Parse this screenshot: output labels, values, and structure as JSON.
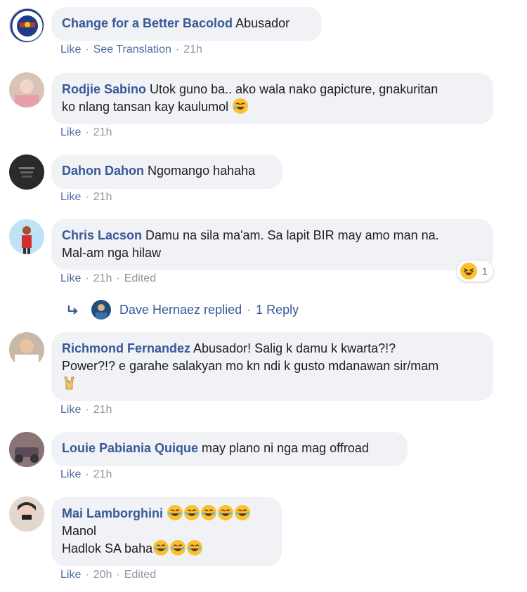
{
  "comments": [
    {
      "author": "Change for a Better Bacolod",
      "text": "Abusador",
      "actions": {
        "like": "Like",
        "see_translation": "See Translation",
        "time": "21h"
      }
    },
    {
      "author": "Rodjie Sabino",
      "text": "Utok guno ba.. ako wala nako gapicture, gnakuritan",
      "text2": "ko nlang tansan kay kaulumol",
      "actions": {
        "like": "Like",
        "time": "21h"
      }
    },
    {
      "author": "Dahon Dahon",
      "text": "Ngomango hahaha",
      "actions": {
        "like": "Like",
        "time": "21h"
      }
    },
    {
      "author": "Chris Lacson",
      "text": "Damu na sila ma'am. Sa lapit BIR may amo man na.",
      "text2": "Mal-am nga hilaw",
      "actions": {
        "like": "Like",
        "time": "21h",
        "edited": "Edited"
      },
      "reaction_count": "1"
    },
    {
      "author": "Richmond Fernandez",
      "text": "Abusador! Salig k damu k kwarta?!?",
      "text2": "Power?!? e garahe salakyan mo kn ndi k gusto mdanawan sir/mam",
      "actions": {
        "like": "Like",
        "time": "21h"
      }
    },
    {
      "author": "Louie Pabiania Quique",
      "text": "may plano ni nga mag offroad",
      "actions": {
        "like": "Like",
        "time": "21h"
      }
    },
    {
      "author": "Mai Lamborghini",
      "text2": "Manol",
      "text3": "Hadlok SA baha",
      "actions": {
        "like": "Like",
        "time": "20h",
        "edited": "Edited"
      }
    }
  ],
  "reply": {
    "text": "Dave Hernaez replied",
    "count": "1 Reply"
  },
  "icons": {
    "laugh": "laughing-emoji-icon",
    "rolling": "rolling-laugh-emoji-icon",
    "horns": "rock-on-hand-icon",
    "reply_arrow": "reply-arrow-icon"
  },
  "colors": {
    "author": "#385898",
    "bubble": "#f0f2f5",
    "meta": "#90949c",
    "emoji": "#fbc02d"
  }
}
